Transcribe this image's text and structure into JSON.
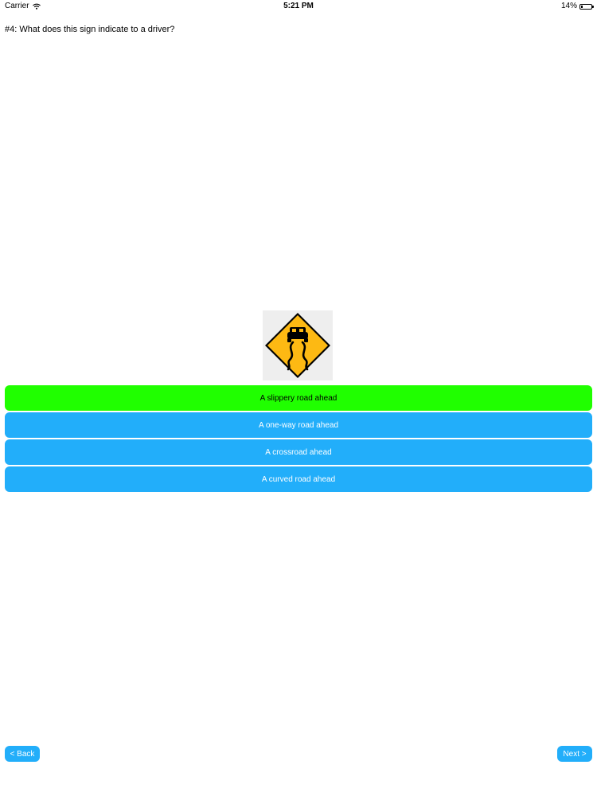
{
  "status_bar": {
    "carrier": "Carrier",
    "time": "5:21 PM",
    "battery": "14%",
    "battery_level": 0.14,
    "icons": [
      "wifi-icon",
      "battery-icon"
    ]
  },
  "question": {
    "text": "#4: What does this sign indicate to a driver?"
  },
  "sign": {
    "icon": "slippery-road-sign",
    "colors": {
      "sign": "#fdb913",
      "symbol": "#000000",
      "background": "#eeeeee"
    }
  },
  "answers": [
    {
      "label": "A slippery road ahead",
      "state": "correct"
    },
    {
      "label": "A one-way road ahead",
      "state": "normal"
    },
    {
      "label": "A crossroad ahead",
      "state": "normal"
    },
    {
      "label": "A curved road ahead",
      "state": "normal"
    }
  ],
  "nav": {
    "back_label": "< Back",
    "next_label": "Next >"
  },
  "colors": {
    "correct": "#20ff00",
    "button": "#22aefa",
    "button_text": "#ffffff"
  }
}
